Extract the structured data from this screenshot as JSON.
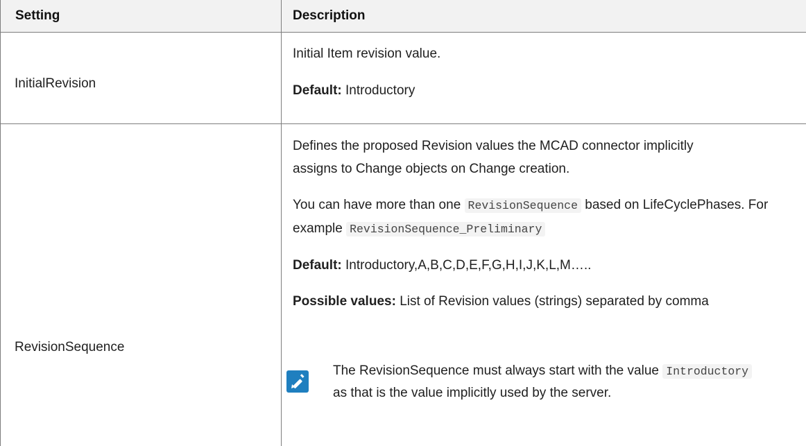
{
  "table": {
    "headers": {
      "setting": "Setting",
      "description": "Description"
    },
    "rows": [
      {
        "setting": "InitialRevision",
        "description": "Initial Item revision value.",
        "default_label": "Default:",
        "default_value": "Introductory"
      },
      {
        "setting": "RevisionSequence",
        "description": "Defines the proposed Revision values the MCAD connector implicitly assigns to Change objects on Change creation.",
        "multi_pre": "You can have more than one",
        "multi_code": "RevisionSequence",
        "multi_mid": "based on LifeCyclePhases. For example",
        "multi_example": "RevisionSequence_Preliminary",
        "default_label": "Default:",
        "default_value": "Introductory,A,B,C,D,E,F,G,H,I,J,K,L,M…..",
        "possible_label": "Possible values:",
        "possible_value": "List of Revision values (strings) separated by comma",
        "note": {
          "icon": "note-pencil-icon",
          "text_pre": "The RevisionSequence must always start with the value",
          "code": "Introductory",
          "text_post": "as that is the value implicitly used by the server."
        }
      }
    ]
  },
  "colors": {
    "header_bg": "#f2f2f2",
    "border": "#7d7d7d",
    "note_icon": "#1f7fbf",
    "code_bg": "#f3f3f3"
  }
}
